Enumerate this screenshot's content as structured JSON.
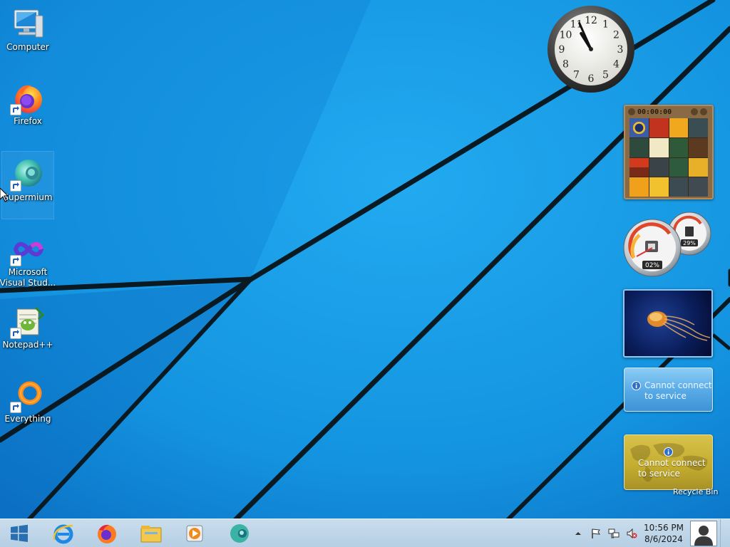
{
  "desktop": {
    "icons": [
      {
        "label": "Computer",
        "icon": "computer-icon"
      },
      {
        "label": "Firefox",
        "icon": "firefox-icon",
        "shortcut": true
      },
      {
        "label": "Supermium",
        "icon": "supermium-icon",
        "shortcut": true,
        "selected": true
      },
      {
        "label": "Microsoft Visual Stud...",
        "icon": "visual-studio-icon",
        "shortcut": true
      },
      {
        "label": "Notepad++",
        "icon": "notepadpp-icon",
        "shortcut": true
      },
      {
        "label": "Everything",
        "icon": "everything-icon",
        "shortcut": true
      }
    ],
    "recycle_bin_label": "Recycle Bin"
  },
  "gadgets": {
    "clock": {
      "numbers": [
        "12",
        "1",
        "2",
        "3",
        "4",
        "5",
        "6",
        "7",
        "8",
        "9",
        "10",
        "11"
      ],
      "hour": 10,
      "minute": 56
    },
    "puzzle": {
      "timer": "00:00:00"
    },
    "cpu_meter": {
      "cpu_percent": "02%",
      "memory_percent": "29%"
    },
    "slideshow": {
      "subject": "jellyfish"
    },
    "weather": {
      "message": "Cannot connect to service"
    },
    "currency": {
      "message": "Cannot connect to service"
    }
  },
  "taskbar": {
    "pinned": [
      {
        "name": "internet-explorer-icon"
      },
      {
        "name": "firefox-icon"
      },
      {
        "name": "file-explorer-icon"
      },
      {
        "name": "media-player-icon"
      },
      {
        "name": "supermium-icon"
      }
    ],
    "tray": [
      "show-hidden-icons",
      "action-center-flag-icon",
      "network-icon",
      "volume-muted-icon"
    ],
    "time": "10:56 PM",
    "date": "8/6/2024"
  },
  "colors": {
    "wallpaper": "#1298e4",
    "wallpaper_dark": "#0a6bc0",
    "taskbar": "#c2d8eb",
    "weather_gadget": "#56a9e5",
    "currency_gadget": "#c3ab2f"
  }
}
